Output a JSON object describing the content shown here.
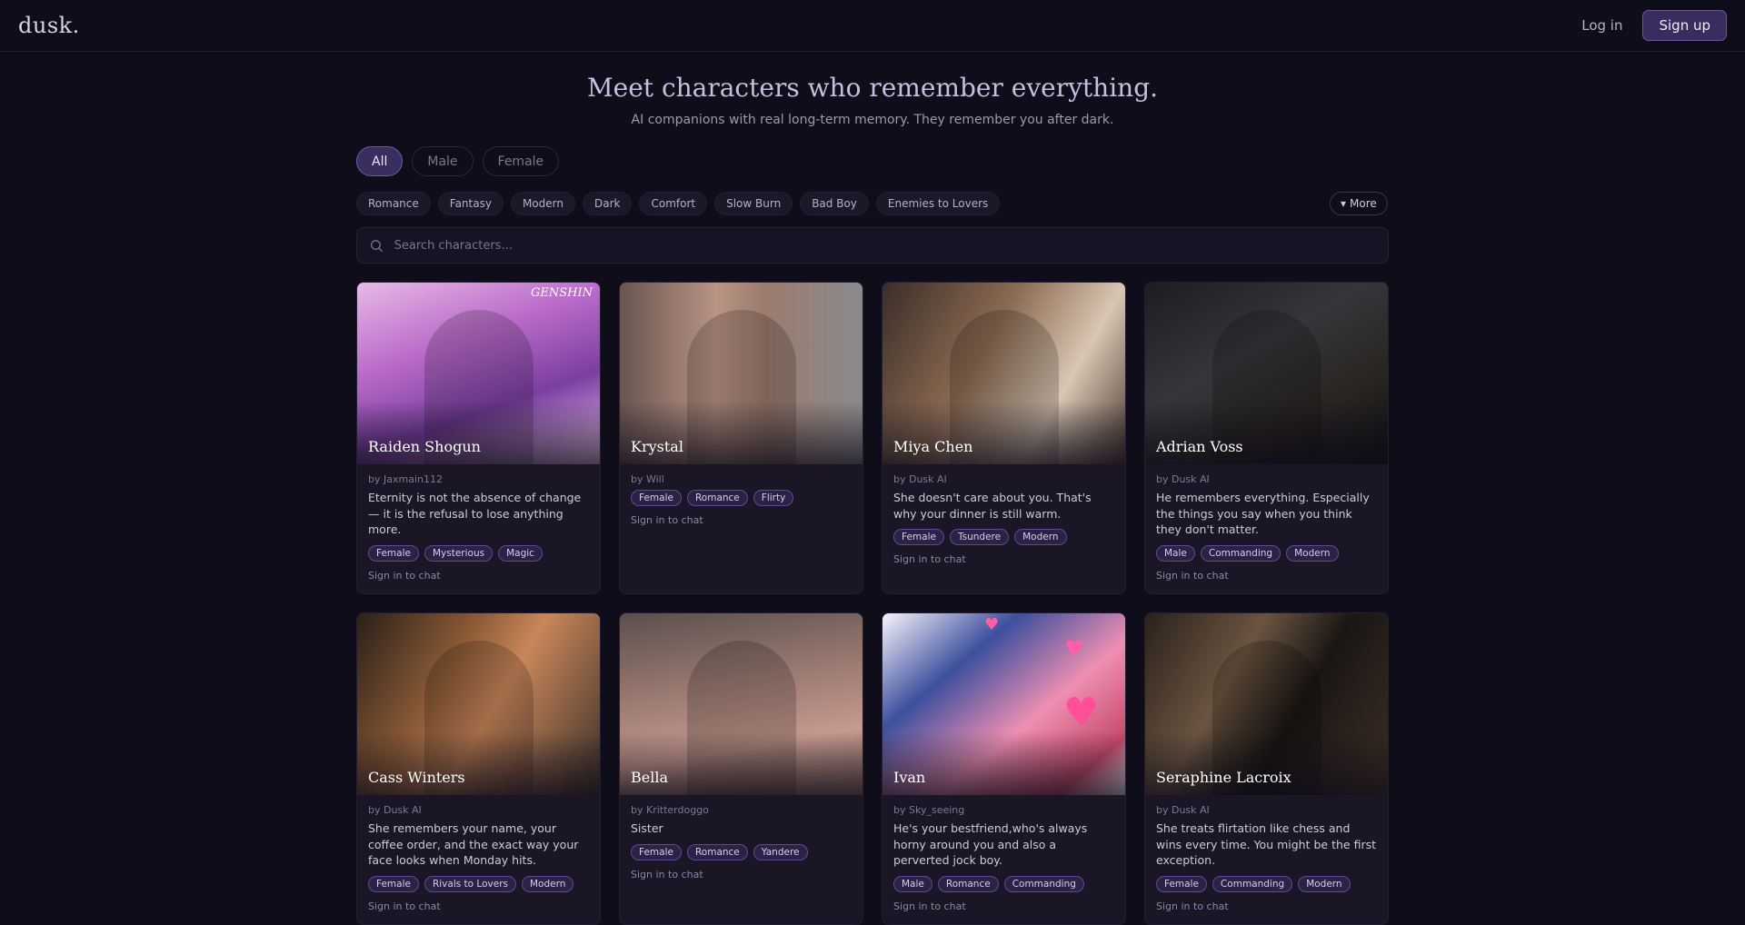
{
  "brand": {
    "logo": "dusk."
  },
  "auth": {
    "login": "Log in",
    "signup": "Sign up"
  },
  "hero": {
    "title": "Meet characters who remember everything.",
    "subtitle": "AI companions with real long-term memory. They remember you after dark."
  },
  "gender_filters": [
    "All",
    "Male",
    "Female"
  ],
  "active_gender": "All",
  "genres": [
    "Romance",
    "Fantasy",
    "Modern",
    "Dark",
    "Comfort",
    "Slow Burn",
    "Bad Boy",
    "Enemies to Lovers"
  ],
  "more_label": "More",
  "search": {
    "placeholder": "Search characters..."
  },
  "signin_label": "Sign in to chat",
  "cards": [
    {
      "name": "Raiden Shogun",
      "author": "by Jaxmain112",
      "desc": "Eternity is not the absence of change — it is the refusal to lose anything more.",
      "tags": [
        "Female",
        "Mysterious",
        "Magic"
      ],
      "watermark": "GENSHIN"
    },
    {
      "name": "Krystal",
      "author": "by Will",
      "desc": "",
      "tags": [
        "Female",
        "Romance",
        "Flirty"
      ]
    },
    {
      "name": "Miya Chen",
      "author": "by Dusk AI",
      "desc": "She doesn't care about you. That's why your dinner is still warm.",
      "tags": [
        "Female",
        "Tsundere",
        "Modern"
      ]
    },
    {
      "name": "Adrian Voss",
      "author": "by Dusk AI",
      "desc": "He remembers everything. Especially the things you say when you think they don't matter.",
      "tags": [
        "Male",
        "Commanding",
        "Modern"
      ]
    },
    {
      "name": "Cass Winters",
      "author": "by Dusk AI",
      "desc": "She remembers your name, your coffee order, and the exact way your face looks when Monday hits.",
      "tags": [
        "Female",
        "Rivals to Lovers",
        "Modern"
      ]
    },
    {
      "name": "Bella",
      "author": "by Kritterdoggo",
      "desc": "Sister",
      "tags": [
        "Female",
        "Romance",
        "Yandere"
      ]
    },
    {
      "name": "Ivan",
      "author": "by Sky_seeing",
      "desc": "He's your bestfriend,who's always horny around you and also a perverted jock boy.",
      "tags": [
        "Male",
        "Romance",
        "Commanding"
      ]
    },
    {
      "name": "Seraphine Lacroix",
      "author": "by Dusk AI",
      "desc": "She treats flirtation like chess and wins every time. You might be the first exception.",
      "tags": [
        "Female",
        "Commanding",
        "Modern"
      ]
    }
  ],
  "icons": {
    "search": "search-icon",
    "more": "caret-down-icon"
  }
}
